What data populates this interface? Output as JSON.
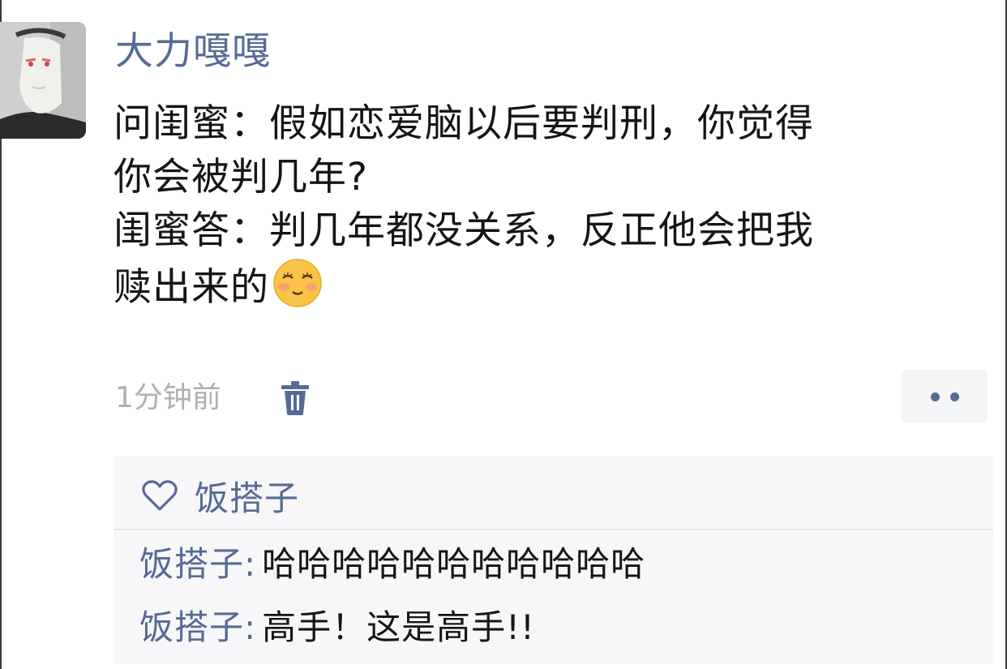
{
  "post": {
    "author": "大力嘎嘎",
    "text_lines": [
      "问闺蜜：假如恋爱脑以后要判刑，你觉得",
      "你会被判几年?",
      "闺蜜答：判几年都没关系，反正他会把我",
      "赎出来的"
    ],
    "emoji": "smiling-face-with-closed-eyes-emoji",
    "time": "1分钟前",
    "delete_icon": "trash-icon",
    "more_icon": "more-dots-icon"
  },
  "likes": {
    "icon": "heart-icon",
    "names": "饭搭子"
  },
  "comments": [
    {
      "author": "饭搭子",
      "sep": ":",
      "text": "哈哈哈哈哈哈哈哈哈哈哈"
    },
    {
      "author": "饭搭子",
      "sep": ":",
      "text": "高手！这是高手!!"
    }
  ],
  "colors": {
    "name_blue": "#566b94",
    "body_text": "#151515",
    "meta_gray": "#b0b0b0",
    "comment_bg": "#f7f7f9"
  }
}
